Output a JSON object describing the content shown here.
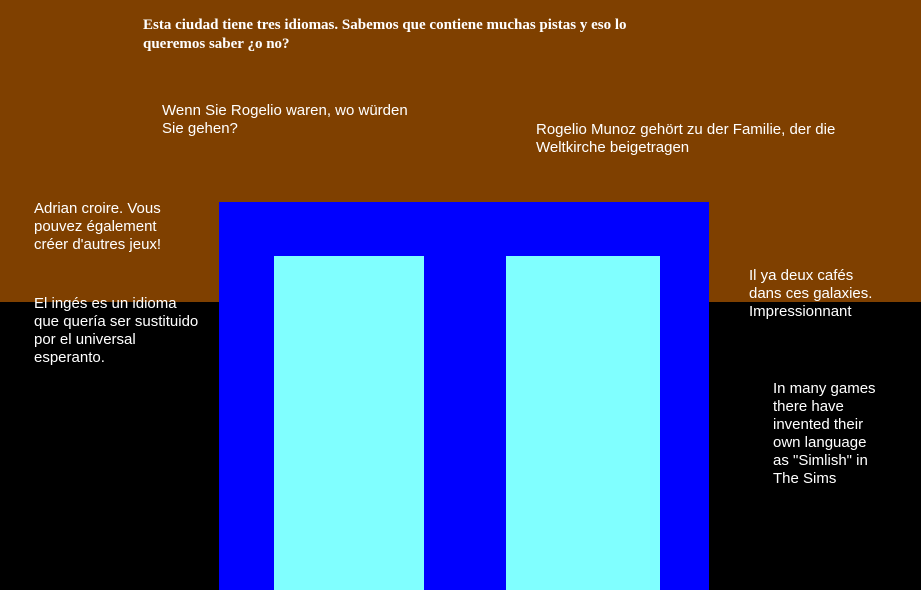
{
  "colors": {
    "sky": "#7f4000",
    "ground": "#000000",
    "building": "#0000ff",
    "window": "#80ffff",
    "text": "#ffffff"
  },
  "headline": "Esta ciudad tiene tres idiomas. Sabemos que contiene muchas pistas y eso lo\nqueremos saber ¿o no?",
  "messages": {
    "german_question": "Wenn Sie Rogelio waren, wo würden\nSie gehen?",
    "german_family": "Rogelio Munoz gehört zu der Familie, der die\nWeltkirche beigetragen",
    "french_games": "Adrian croire. Vous\npouvez également\ncréer d'autres jeux!",
    "spanish_esperanto": "El ingés es un idioma\nque quería ser sustituido\npor el universal\nesperanto.",
    "french_cafes": "Il ya deux cafés\ndans ces galaxies.\nImpressionnant",
    "english_simlish": "In many games\nthere have\ninvented their\nown language\nas \"Simlish\" in\nThe Sims"
  }
}
